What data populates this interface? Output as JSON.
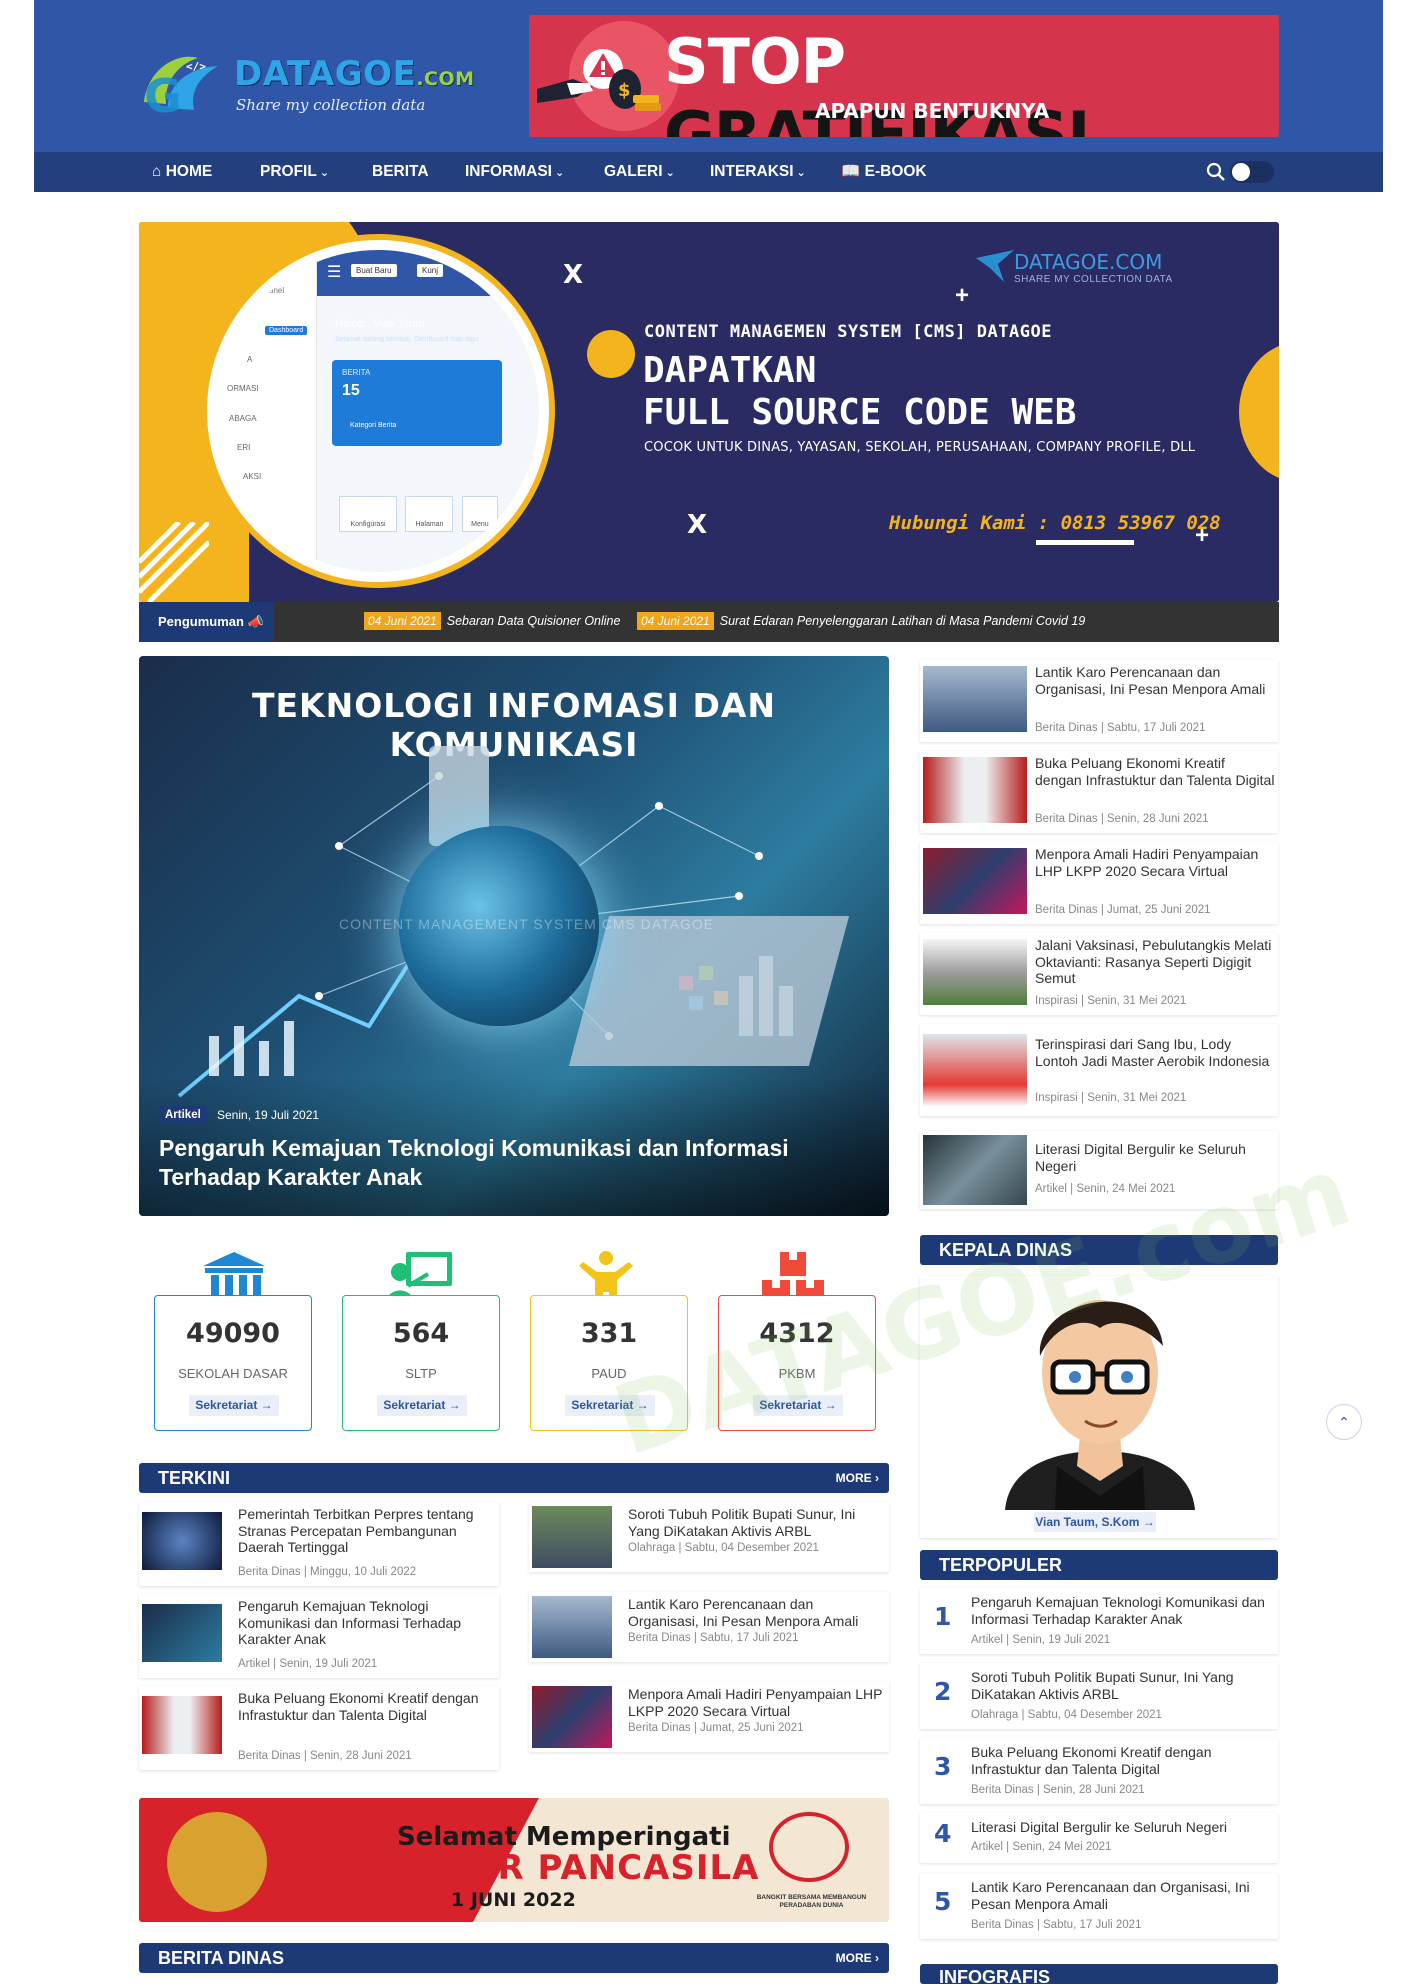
{
  "header": {
    "logo": {
      "name": "DATAGOE",
      "dotcom": ".COM",
      "tagline": "Share my collection data"
    },
    "ad": {
      "line1": "STOP",
      "line2": "GRATIFIKASI",
      "line3": "APAPUN BENTUKNYA"
    }
  },
  "nav": {
    "items": [
      {
        "label": "HOME",
        "icon": "home-icon",
        "has_dropdown": false
      },
      {
        "label": "PROFIL",
        "has_dropdown": true
      },
      {
        "label": "BERITA",
        "has_dropdown": false
      },
      {
        "label": "INFORMASI",
        "has_dropdown": true
      },
      {
        "label": "GALERI",
        "has_dropdown": true
      },
      {
        "label": "INTERAKSI",
        "has_dropdown": true
      },
      {
        "label": "E-BOOK",
        "icon": "book-icon",
        "has_dropdown": false
      }
    ],
    "caret": "⌄"
  },
  "hero": {
    "brand": "DATAGOE.COM",
    "brand_sub": "SHARE MY COLLECTION DATA",
    "line1": "CONTENT MANAGEMEN SYSTEM [CMS] DATAGOE",
    "line2": "DAPATKAN",
    "line3": "FULL SOURCE CODE WEB",
    "line4": "COCOK UNTUK DINAS, YAYASAN, SEKOLAH, PERUSAHAAN, COMPANY PROFILE, DLL",
    "line5": "Hubungi Kami : 0813 53967 028",
    "screen": {
      "btn": "Buat Baru",
      "btn2": "Kunj",
      "greeting": "Haloo.. Vian Taum",
      "greeting_sub": "Selamat datang kembali, Dashboard siap digu",
      "card_label": "BERITA",
      "card_value": "15",
      "card_link": "Kategori Berita",
      "side_badge": "Dashboard",
      "side_label": "anel",
      "side_items": [
        "A",
        "ORMASI",
        "ABAGA",
        "ERI",
        "AKSI"
      ],
      "tiles": [
        "Konfigurasi",
        "Halaman",
        "Menu"
      ]
    }
  },
  "ticker": {
    "label": "Pengumuman",
    "items": [
      {
        "date": "04 Juni 2021",
        "text": "Sebaran Data Quisioner Online"
      },
      {
        "date": "04 Juni 2021",
        "text": "Surat Edaran Penyelenggaran Latihan di Masa Pandemi Covid 19"
      }
    ]
  },
  "featured": {
    "image_title": "TEKNOLOGI INFOMASI DAN KOMUNIKASI",
    "image_caption": "CONTENT MANAGEMENT SYSTEM CMS DATAGOE",
    "category": "Artikel",
    "date": "Senin, 19 Juli 2021",
    "title": "Pengaruh Kemajuan Teknologi Komunikasi dan Informasi Terhadap Karakter Anak"
  },
  "side_news": [
    {
      "title": "Lantik Karo Perencanaan dan Organisasi, Ini Pesan Menpora Amali",
      "meta": "Berita Dinas | Sabtu, 17 Juli 2021"
    },
    {
      "title": "Buka Peluang Ekonomi Kreatif dengan Infrastuktur dan Talenta Digital",
      "meta": "Berita Dinas | Senin, 28 Juni 2021"
    },
    {
      "title": "Menpora Amali Hadiri Penyampaian LHP LKPP 2020 Secara Virtual",
      "meta": "Berita Dinas | Jumat, 25 Juni 2021"
    },
    {
      "title": "Jalani Vaksinasi, Pebulutangkis Melati Oktavianti: Rasanya Seperti Digigit Semut",
      "meta": "Inspirasi | Senin, 31 Mei 2021"
    },
    {
      "title": "Terinspirasi dari Sang Ibu, Lody Lontoh Jadi Master Aerobik Indonesia",
      "meta": "Inspirasi | Senin, 31 Mei 2021"
    },
    {
      "title": "Literasi Digital Bergulir ke Seluruh Negeri",
      "meta": "Artikel | Senin, 24 Mei 2021"
    }
  ],
  "stats": [
    {
      "value": "49090",
      "label": "SEKOLAH DASAR",
      "button": "Sekretariat →",
      "color": "#1e88d4"
    },
    {
      "value": "564",
      "label": "SLTP",
      "button": "Sekretariat →",
      "color": "#1fbf75"
    },
    {
      "value": "331",
      "label": "PAUD",
      "button": "Sekretariat →",
      "color": "#f2c318"
    },
    {
      "value": "4312",
      "label": "PKBM",
      "button": "Sekretariat →",
      "color": "#f04b3a"
    }
  ],
  "terkini": {
    "title": "TERKINI",
    "more": "MORE ›",
    "left": [
      {
        "title": "Pemerintah Terbitkan Perpres tentang Stranas Percepatan Pembangunan Daerah Tertinggal",
        "meta": "Berita Dinas | Minggu, 10 Juli 2022"
      },
      {
        "title": "Pengaruh Kemajuan Teknologi Komunikasi dan Informasi Terhadap Karakter Anak",
        "meta": "Artikel | Senin, 19 Juli 2021"
      },
      {
        "title": "Buka Peluang Ekonomi Kreatif dengan Infrastuktur dan Talenta Digital",
        "meta": "Berita Dinas | Senin, 28 Juni 2021"
      }
    ],
    "right": [
      {
        "title": "Soroti Tubuh Politik Bupati Sunur, Ini Yang DiKatakan Aktivis ARBL",
        "meta": "Olahraga | Sabtu, 04 Desember 2021"
      },
      {
        "title": "Lantik Karo Perencanaan dan Organisasi, Ini Pesan Menpora Amali",
        "meta": "Berita Dinas | Sabtu, 17 Juli 2021"
      },
      {
        "title": "Menpora Amali Hadiri Penyampaian LHP LKPP 2020 Secara Virtual",
        "meta": "Berita Dinas | Jumat, 25 Juni 2021"
      }
    ]
  },
  "pancasila": {
    "line1": "Selamat Memperingati",
    "line2": "HARI LAHIR PANCASILA",
    "line3": "1 JUNI 2022",
    "caption": "BANGKIT BERSAMA MEMBANGUN PERADABAN DUNIA"
  },
  "berita_dinas": {
    "title": "BERITA DINAS",
    "more": "MORE ›"
  },
  "kepala_dinas": {
    "title": "KEPALA DINAS",
    "name": "Vian Taum, S.Kom →"
  },
  "terpopuler": {
    "title": "TERPOPULER",
    "items": [
      {
        "n": "1",
        "title": "Pengaruh Kemajuan Teknologi Komunikasi dan Informasi Terhadap Karakter Anak",
        "meta": "Artikel | Senin, 19 Juli 2021"
      },
      {
        "n": "2",
        "title": "Soroti Tubuh Politik Bupati Sunur, Ini Yang DiKatakan Aktivis ARBL",
        "meta": "Olahraga | Sabtu, 04 Desember 2021"
      },
      {
        "n": "3",
        "title": "Buka Peluang Ekonomi Kreatif dengan Infrastuktur dan Talenta Digital",
        "meta": "Berita Dinas | Senin, 28 Juni 2021"
      },
      {
        "n": "4",
        "title": "Literasi Digital Bergulir ke Seluruh Negeri",
        "meta": "Artikel | Senin, 24 Mei 2021"
      },
      {
        "n": "5",
        "title": "Lantik Karo Perencanaan dan Organisasi, Ini Pesan Menpora Amali",
        "meta": "Berita Dinas | Sabtu, 17 Juli 2021"
      }
    ]
  },
  "infografis": {
    "title": "INFOGRAFIS"
  },
  "watermark": "DATAGOE.com",
  "colors": {
    "primary": "#2f56a7",
    "dark": "#1e3a76",
    "accent": "#f3b41d",
    "ad_red": "#d6334d"
  }
}
